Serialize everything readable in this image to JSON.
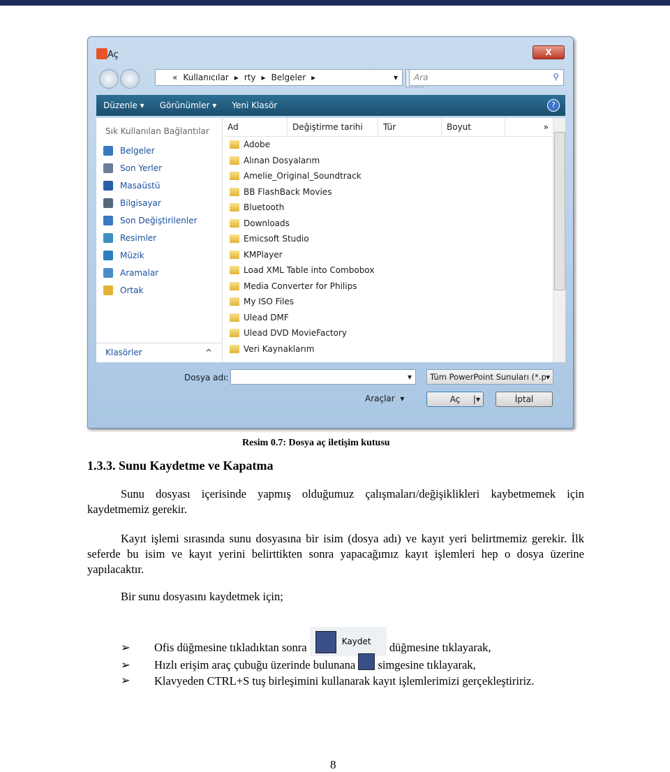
{
  "dialog": {
    "title": "Aç",
    "close": "X",
    "breadcrumb": [
      "«",
      "Kullanıcılar",
      "rty",
      "Belgeler"
    ],
    "search_placeholder": "Ara",
    "toolbar": {
      "organize": "Düzenle ▾",
      "views": "Görünümler ▾",
      "new_folder": "Yeni Klasör",
      "help": "?"
    },
    "sidebar": {
      "header": "Sık Kullanılan Bağlantılar",
      "items": [
        {
          "label": "Belgeler",
          "color": "#3a78c2"
        },
        {
          "label": "Son Yerler",
          "color": "#6a7f9a"
        },
        {
          "label": "Masaüstü",
          "color": "#2a5ea8"
        },
        {
          "label": "Bilgisayar",
          "color": "#55677d"
        },
        {
          "label": "Son Değiştirilenler",
          "color": "#3a78c2"
        },
        {
          "label": "Resimler",
          "color": "#3e8fbf"
        },
        {
          "label": "Müzik",
          "color": "#2b7fc0"
        },
        {
          "label": "Aramalar",
          "color": "#4b8bc8"
        },
        {
          "label": "Ortak",
          "color": "#e2b437"
        }
      ],
      "folders": "Klasörler",
      "folders_chevron": "^"
    },
    "columns": [
      "Ad",
      "Değiştirme tarihi",
      "Tür",
      "Boyut",
      "»"
    ],
    "files": [
      "Adobe",
      "Alınan Dosyalarım",
      "Amelie_Original_Soundtrack",
      "BB FlashBack Movies",
      "Bluetooth",
      "Downloads",
      "Emicsoft Studio",
      "KMPlayer",
      "Load XML Table into Combobox",
      "Media Converter for Philips",
      "My ISO Files",
      "Ulead DMF",
      "Ulead DVD MovieFactory",
      "Veri Kaynaklarım"
    ],
    "filename_label": "Dosya adı:",
    "filename_value": "",
    "filetype": "Tüm PowerPoint Sunuları (*.p",
    "tools": "Araçlar",
    "open": "Aç",
    "cancel": "İptal"
  },
  "caption": "Resim 0.7:  Dosya aç iletişim kutusu",
  "heading": "1.3.3. Sunu Kaydetme ve Kapatma",
  "paragraphs": [
    "Sunu dosyası içerisinde yapmış olduğumuz çalışmaları/değişiklikleri kaybetmemek için kaydetmemiz gerekir.",
    "Kayıt işlemi sırasında sunu dosyasına bir isim (dosya adı) ve kayıt yeri belirtmemiz gerekir. İlk seferde bu isim ve kayıt yerini belirttikten sonra yapacağımız kayıt işlemleri hep o dosya üzerine yapılacaktır.",
    "Bir sunu dosyasını kaydetmek için;"
  ],
  "bullets": [
    {
      "before": "Ofis düğmesine tıkladıktan sonra",
      "icon_label": "Kaydet",
      "after": "düğmesine tıklayarak,"
    },
    {
      "before": "Hızlı erişim araç çubuğu üzerinde bulunana",
      "after": "simgesine tıklayarak,"
    },
    {
      "text": "Klavyeden CTRL+S tuş birleşimini kullanarak kayıt işlemlerimizi gerçekleştiririz."
    }
  ],
  "bullet_marker": "➢",
  "page_number": "8"
}
